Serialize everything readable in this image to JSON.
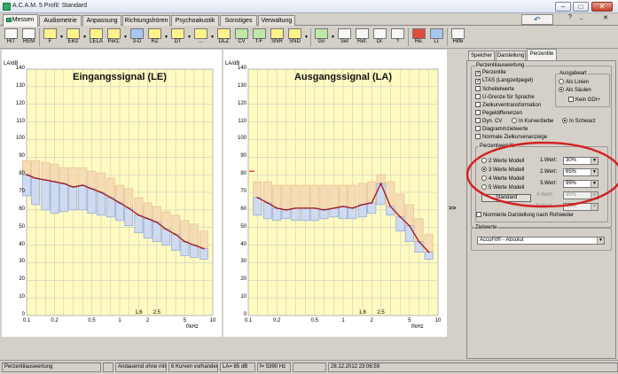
{
  "window": {
    "title": "A.C.A.M. 5  Profil: Standard"
  },
  "tabs": [
    {
      "label": "Messen",
      "active": true
    },
    {
      "label": "Audiometrie"
    },
    {
      "label": "Anpassung"
    },
    {
      "label": "Richtungshören"
    },
    {
      "label": "Psychoakustik"
    },
    {
      "label": "Sonstiges"
    },
    {
      "label": "Verwaltung"
    }
  ],
  "toolbar": [
    {
      "label": "HIT",
      "icon": "ear-icon"
    },
    {
      "label": "REM",
      "icon": "ear-icon"
    },
    {
      "label": "F",
      "icon": "chart-icon"
    },
    {
      "label": "Einz",
      "icon": "chart-icon"
    },
    {
      "label": "LELA",
      "icon": "chart-icon"
    },
    {
      "label": "Perz.",
      "icon": "chart-icon"
    },
    {
      "label": "3-D",
      "icon": "chart-icon"
    },
    {
      "label": "RZ",
      "icon": "chart-icon"
    },
    {
      "label": "DT",
      "icon": "chart-icon"
    },
    {
      "label": "...",
      "icon": "chart-icon"
    },
    {
      "label": "DLZ",
      "icon": "chart-icon"
    },
    {
      "label": "CV",
      "icon": "chart-icon"
    },
    {
      "label": "f-F",
      "icon": "chart-icon"
    },
    {
      "label": "SNR",
      "icon": "chart-icon"
    },
    {
      "label": "SND",
      "icon": "chart-icon"
    },
    {
      "label": "Go",
      "icon": "run-icon"
    },
    {
      "label": "Set",
      "icon": "tools-icon"
    },
    {
      "label": "Ref.",
      "icon": "glasses-icon"
    },
    {
      "label": "Dr.",
      "icon": "printer-icon"
    },
    {
      "label": "?",
      "icon": "help-icon"
    },
    {
      "label": "Re.",
      "icon": "right-ear-icon"
    },
    {
      "label": "Li.",
      "icon": "left-ear-icon"
    },
    {
      "label": "Hilfe",
      "icon": "help-book-icon"
    }
  ],
  "charts": {
    "y_unit": "LA/dB",
    "x_unit": "f/kHz",
    "left_title": "Eingangssignal (LE)",
    "right_title": "Ausgangssignal (LA)",
    "y_ticks": [
      "140",
      "130",
      "120",
      "110",
      "100",
      "90",
      "80",
      "70",
      "60",
      "50",
      "40",
      "30",
      "20",
      "10",
      "0"
    ],
    "x_ticks": [
      "0.1",
      "0.2",
      "0.5",
      "1",
      "1.6",
      "2",
      "2.5",
      "5",
      "10"
    ]
  },
  "chart_data": [
    {
      "type": "bar",
      "title": "Eingangssignal (LE)",
      "xlabel": "f/kHz",
      "ylabel": "LA/dB",
      "x_scale": "log",
      "xlim": [
        0.1,
        10
      ],
      "ylim": [
        0,
        140
      ],
      "grid": true,
      "series": [
        {
          "name": "",
          "kind": "line",
          "x": [
            0.1,
            0.125,
            0.16,
            0.2,
            0.25,
            0.315,
            0.4,
            0.5,
            0.63,
            0.8,
            1.0,
            1.25,
            1.6,
            2.0,
            2.5,
            3.15,
            4.0,
            5.0,
            6.3,
            8.0
          ],
          "values": [
            80,
            78,
            77,
            76,
            75,
            73,
            74,
            72,
            70,
            67,
            64,
            61,
            57,
            55,
            53,
            49,
            46,
            42,
            40,
            38
          ]
        },
        {
          "name": "",
          "kind": "band",
          "x": [
            0.1,
            0.125,
            0.16,
            0.2,
            0.25,
            0.315,
            0.4,
            0.5,
            0.63,
            0.8,
            1.0,
            1.25,
            1.6,
            2.0,
            2.5,
            3.15,
            4.0,
            5.0,
            6.3,
            8.0
          ],
          "low": [
            68,
            63,
            60,
            58,
            59,
            60,
            60,
            58,
            57,
            56,
            54,
            51,
            47,
            44,
            42,
            40,
            37,
            34,
            33,
            32
          ],
          "high": [
            88,
            88,
            87,
            86,
            84,
            84,
            84,
            82,
            81,
            78,
            74,
            72,
            67,
            64,
            62,
            59,
            57,
            54,
            52,
            48
          ]
        }
      ]
    },
    {
      "type": "bar",
      "title": "Ausgangssignal (LA)",
      "xlabel": "f/kHz",
      "ylabel": "LA/dB",
      "x_scale": "log",
      "xlim": [
        0.1,
        10
      ],
      "ylim": [
        0,
        140
      ],
      "grid": true,
      "series": [
        {
          "name": "",
          "kind": "line",
          "x": [
            0.125,
            0.16,
            0.2,
            0.25,
            0.315,
            0.4,
            0.5,
            0.63,
            0.8,
            1.0,
            1.25,
            1.6,
            2.0,
            2.5,
            3.15,
            4.0,
            5.0,
            6.3,
            8.0
          ],
          "values": [
            67,
            64,
            61,
            60,
            61,
            61,
            61,
            60,
            61,
            62,
            61,
            63,
            64,
            75,
            62,
            56,
            51,
            42,
            36
          ]
        },
        {
          "name": "",
          "kind": "band",
          "x": [
            0.125,
            0.16,
            0.2,
            0.25,
            0.315,
            0.4,
            0.5,
            0.63,
            0.8,
            1.0,
            1.25,
            1.6,
            2.0,
            2.5,
            3.15,
            4.0,
            5.0,
            6.3,
            8.0
          ],
          "low": [
            57,
            55,
            54,
            55,
            54,
            54,
            54,
            55,
            56,
            55,
            55,
            56,
            58,
            63,
            57,
            48,
            42,
            36,
            32
          ],
          "high": [
            76,
            76,
            74,
            74,
            74,
            74,
            74,
            74,
            74,
            74,
            74,
            75,
            76,
            80,
            76,
            69,
            63,
            55,
            46
          ]
        }
      ],
      "marker_left": 82
    }
  ],
  "expand_arrow": ">>",
  "right_panel": {
    "tabs": [
      {
        "label": "Speicher"
      },
      {
        "label": "Darstellung"
      },
      {
        "label": "Perzentile",
        "active": true
      }
    ],
    "group_title": "Perzentilauswertung",
    "checkboxes": [
      {
        "label": "Perzentile",
        "checked": true
      },
      {
        "label": "LTAS (Langzeitpegel)",
        "checked": true
      },
      {
        "label": "Scheitelwerte",
        "checked": false
      },
      {
        "label": "U-Grenze für Sprache",
        "checked": false
      },
      {
        "label": "Zielkurventransformation",
        "checked": false
      },
      {
        "label": "Pegeldifferenzen",
        "checked": false
      },
      {
        "label": "Dyn. CV",
        "checked": false
      },
      {
        "label": "Diagrammzielwerte",
        "checked": false
      },
      {
        "label": "Normale Zielkurvenanzeige",
        "checked": false
      }
    ],
    "ausgabe": {
      "title": "Ausgabeart",
      "options": [
        {
          "label": "Als Linien",
          "on": false
        },
        {
          "label": "Als Säulen",
          "on": true
        }
      ],
      "kein_gdi": "Kein GDI+"
    },
    "color_radios": [
      {
        "label": "In Kurvenfarbe",
        "on": false
      },
      {
        "label": "In Schwarz",
        "on": true
      }
    ],
    "werte_title": "Perzentwert für",
    "model_radios": [
      {
        "label": "2 Werte Modell",
        "on": false
      },
      {
        "label": "3 Werte Modell",
        "on": true
      },
      {
        "label": "4 Werte Modell",
        "on": false
      },
      {
        "label": "5 Werte Modell",
        "on": false
      }
    ],
    "values": [
      {
        "label": "1.Wert:",
        "value": "30%",
        "enabled": true
      },
      {
        "label": "2.Wert:",
        "value": "65%",
        "enabled": true
      },
      {
        "label": "3.Wert:",
        "value": "99%",
        "enabled": true
      },
      {
        "label": "4.Wert:",
        "value": "99%",
        "enabled": false
      },
      {
        "label": "5.Wert:",
        "value": "99%",
        "enabled": false
      }
    ],
    "standard_btn": "Standard",
    "rohwerder": "Normierte Darstellung nach Rohweder",
    "ziel_title": "Zielwerte",
    "ziel_value": "AccuFit® - Absolut"
  },
  "statusbar": [
    "Perzentilauswertung",
    "",
    "Andauernd ohne mitte",
    "6 Kurven vorhanden",
    "LA= 85 dB",
    "f= 5390 Hz",
    "",
    "28.12.2012 23:06:59"
  ],
  "colors": {
    "chart_bg": "#fffbc0",
    "grid": "#c9c9c9",
    "line": "#a0141e",
    "band_upper": "#e9c08a",
    "band_lower": "#8ea7d8",
    "band_upper_fill": "#f4dcb6",
    "band_lower_fill": "#cfdaf0",
    "highlight": "#d52020"
  }
}
